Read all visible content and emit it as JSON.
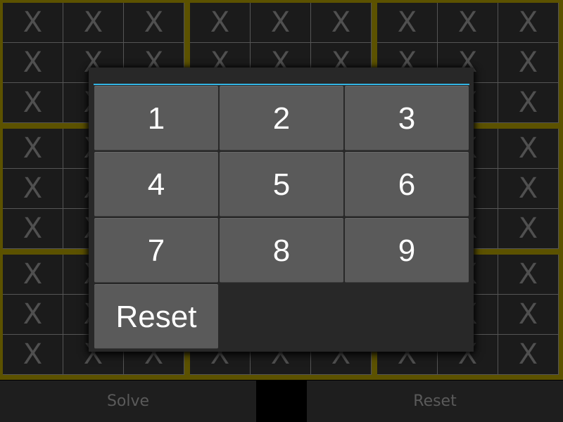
{
  "grid": {
    "cell_placeholder": "X",
    "rows": 9,
    "cols": 9
  },
  "bottom_bar": {
    "solve_label": "Solve",
    "reset_label": "Reset"
  },
  "dialog": {
    "buttons": [
      "1",
      "2",
      "3",
      "4",
      "5",
      "6",
      "7",
      "8",
      "9"
    ],
    "reset_label": "Reset"
  },
  "colors": {
    "box_border": "#5c5200",
    "cell_background": "#1b1b1b",
    "cell_text": "#505050",
    "dialog_accent": "#33b5e5",
    "button_background": "#5a5a5a"
  }
}
